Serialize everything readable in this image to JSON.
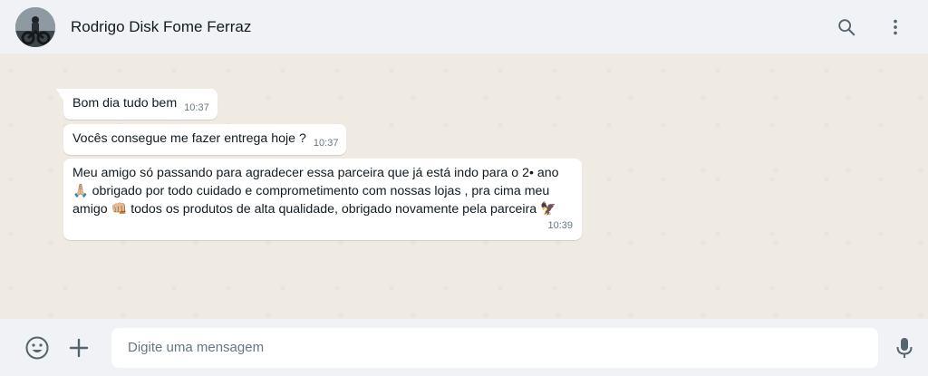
{
  "header": {
    "contact_name": "Rodrigo Disk Fome Ferraz",
    "avatar_icon": "motorcycle-rider-avatar",
    "search_icon": "search-icon",
    "menu_icon": "kebab-menu-icon"
  },
  "messages": [
    {
      "text": "Bom dia tudo bem",
      "time": "10:37"
    },
    {
      "text": "Vocês consegue me fazer entrega hoje ?",
      "time": "10:37"
    },
    {
      "text": "Meu amigo só passando para agradecer essa parceira que já está indo para o 2• ano 🙏🏼 obrigado por todo cuidado e comprometimento com nossas lojas , pra cima meu amigo 👊🏼 todos os produtos de alta qualidade, obrigado novamente pela parceira 🦅",
      "time": "10:39"
    }
  ],
  "composer": {
    "placeholder": "Digite uma mensagem",
    "emoji_icon": "emoji-icon",
    "attach_icon": "plus-icon",
    "mic_icon": "mic-icon"
  },
  "colors": {
    "header_bg": "#f0f2f5",
    "chat_bg": "#efeae2",
    "bubble_bg": "#ffffff",
    "time_text": "#667781",
    "icon": "#54656f"
  }
}
